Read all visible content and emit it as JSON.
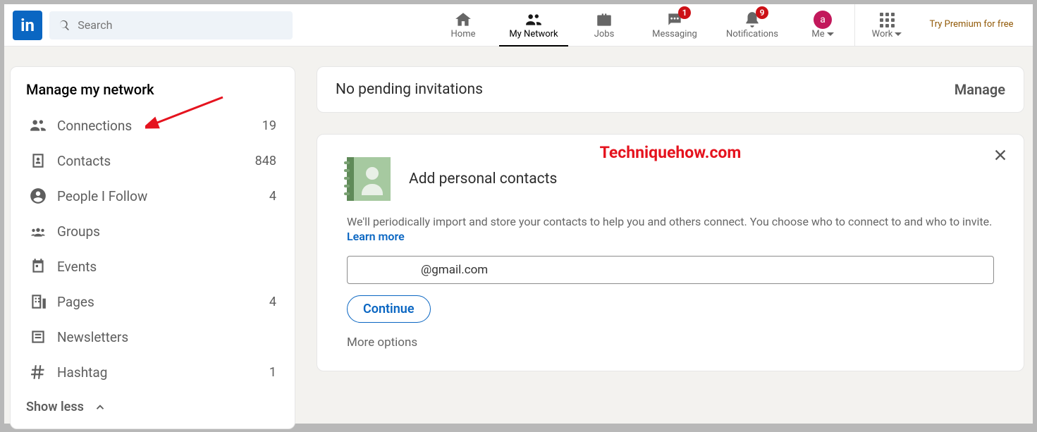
{
  "header": {
    "logo_text": "in",
    "search_placeholder": "Search"
  },
  "nav": {
    "home": "Home",
    "network": "My Network",
    "jobs": "Jobs",
    "messaging": "Messaging",
    "messaging_badge": "1",
    "notifications": "Notifications",
    "notifications_badge": "9",
    "me": "Me",
    "avatar_letter": "a",
    "work": "Work",
    "premium": "Try Premium for free"
  },
  "sidebar": {
    "title": "Manage my network",
    "items": [
      {
        "label": "Connections",
        "count": "19"
      },
      {
        "label": "Contacts",
        "count": "848"
      },
      {
        "label": "People I Follow",
        "count": "4"
      },
      {
        "label": "Groups",
        "count": ""
      },
      {
        "label": "Events",
        "count": ""
      },
      {
        "label": "Pages",
        "count": "4"
      },
      {
        "label": "Newsletters",
        "count": ""
      },
      {
        "label": "Hashtag",
        "count": "1"
      }
    ],
    "show_less": "Show less"
  },
  "invitations": {
    "text": "No pending invitations",
    "manage": "Manage"
  },
  "contacts_card": {
    "watermark": "Techniquehow.com",
    "title": "Add personal contacts",
    "description": "We'll periodically import and store your contacts to help you and others connect. You choose who to connect to and who to invite.",
    "learn_more": "Learn more",
    "email_value": "@gmail.com",
    "continue": "Continue",
    "more_options": "More options"
  }
}
